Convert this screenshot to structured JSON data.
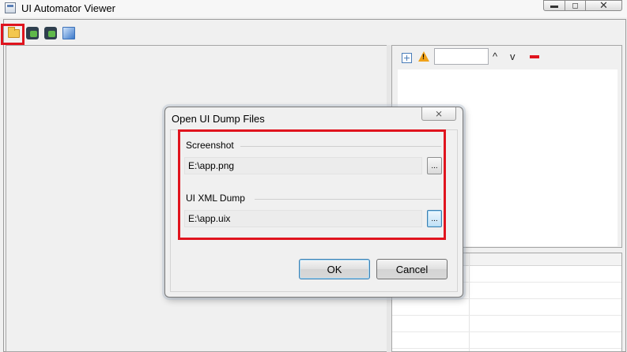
{
  "window": {
    "title": "UI Automator Viewer",
    "minimize_glyph": "▬",
    "maximize_glyph": "◻",
    "close_glyph": "✕"
  },
  "toolbar": {
    "icons": [
      "open-folder-icon",
      "device-screenshot-icon",
      "device-screenshot-compressed-icon",
      "save-icon"
    ]
  },
  "right_panel": {
    "icons": [
      "expand-all-icon",
      "warning-icon",
      "chevron-up-icon",
      "chevron-down-icon",
      "remove-icon"
    ],
    "up_glyph": "^",
    "down_glyph": "v",
    "search_value": ""
  },
  "dialog": {
    "title": "Open UI Dump Files",
    "close_glyph": "⨯",
    "screenshot": {
      "label": "Screenshot",
      "value": "E:\\app.png",
      "browse_label": "..."
    },
    "xml_dump": {
      "label": "UI XML Dump",
      "value": "E:\\app.uix",
      "browse_label": "..."
    },
    "ok_label": "OK",
    "cancel_label": "Cancel"
  },
  "colors": {
    "highlight": "#e0141e",
    "focus_blue": "#3c7fb1",
    "background": "#f0f0f0"
  }
}
